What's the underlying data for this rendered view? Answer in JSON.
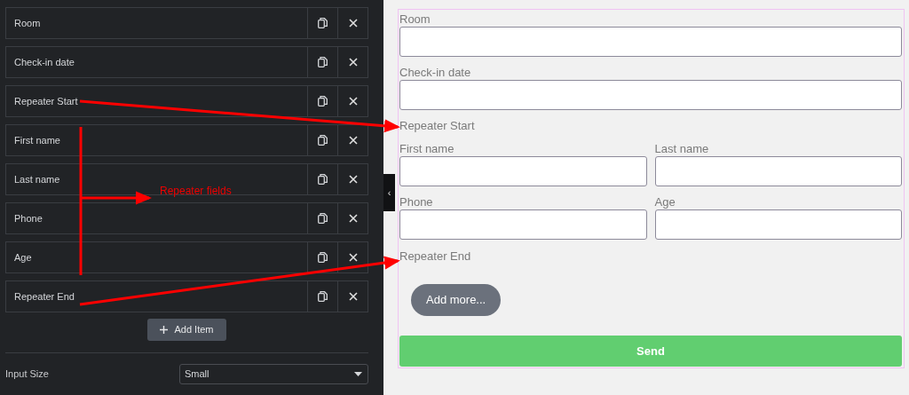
{
  "panel": {
    "items": [
      {
        "label": "Room"
      },
      {
        "label": "Check-in date"
      },
      {
        "label": "Repeater Start"
      },
      {
        "label": "First name"
      },
      {
        "label": "Last name"
      },
      {
        "label": "Phone"
      },
      {
        "label": "Age"
      },
      {
        "label": "Repeater End"
      }
    ],
    "add_button": "Add Item",
    "input_size": {
      "label": "Input Size",
      "value": "Small"
    },
    "collapse_toggle": "‹"
  },
  "form": {
    "rows": [
      {
        "kind": "field",
        "label": "Room"
      },
      {
        "kind": "field",
        "label": "Check-in date"
      },
      {
        "kind": "marker",
        "label": "Repeater Start"
      },
      {
        "kind": "pair",
        "fields": [
          {
            "label": "First name"
          },
          {
            "label": "Last name"
          }
        ]
      },
      {
        "kind": "pair",
        "fields": [
          {
            "label": "Phone"
          },
          {
            "label": "Age"
          }
        ]
      },
      {
        "kind": "marker",
        "label": "Repeater End"
      }
    ],
    "add_more_button": "Add more...",
    "send_button": "Send"
  },
  "annotations": [
    {
      "text": "Repeater fields"
    }
  ]
}
